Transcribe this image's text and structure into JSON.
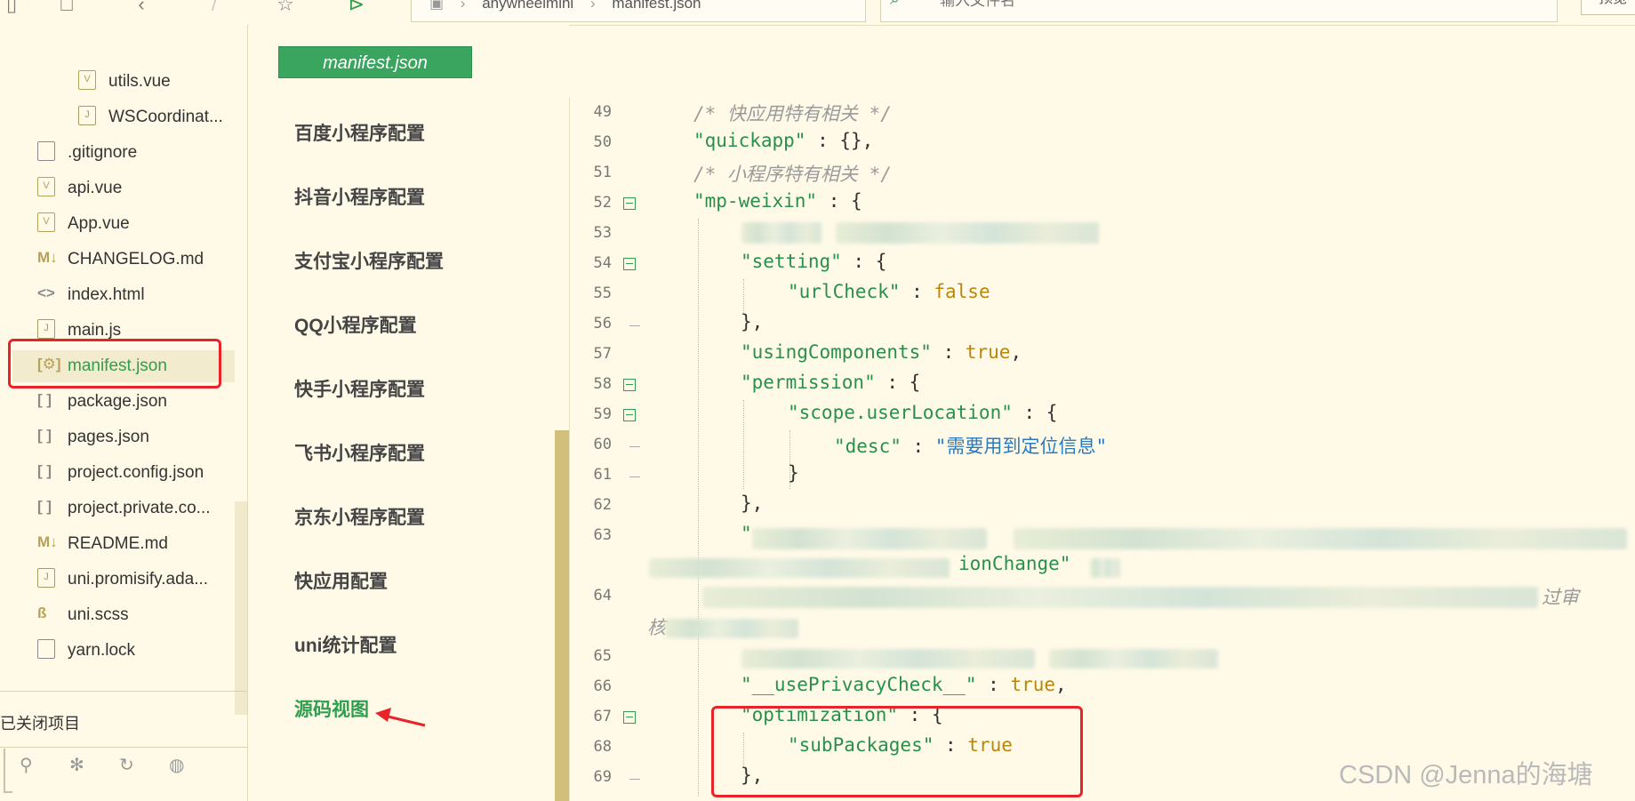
{
  "toolbar": {
    "breadcrumb": [
      "anywheelmini",
      "manifest.json"
    ],
    "search_placeholder": "输入文件名",
    "preview_label": "预览"
  },
  "explorer": {
    "items": [
      {
        "label": "utils.vue",
        "icon": "vue-file-icon"
      },
      {
        "label": "WSCoordinat...",
        "icon": "js-file-icon"
      },
      {
        "label": ".gitignore",
        "icon": "file-icon"
      },
      {
        "label": "api.vue",
        "icon": "vue-file-icon"
      },
      {
        "label": "App.vue",
        "icon": "vue-file-icon"
      },
      {
        "label": "CHANGELOG.md",
        "icon": "markdown-icon"
      },
      {
        "label": "index.html",
        "icon": "html-icon"
      },
      {
        "label": "main.js",
        "icon": "js-file-icon"
      },
      {
        "label": "manifest.json",
        "icon": "settings-file-icon"
      },
      {
        "label": "package.json",
        "icon": "json-icon"
      },
      {
        "label": "pages.json",
        "icon": "json-icon"
      },
      {
        "label": "project.config.json",
        "icon": "json-icon"
      },
      {
        "label": "project.private.co...",
        "icon": "json-icon"
      },
      {
        "label": "README.md",
        "icon": "markdown-icon"
      },
      {
        "label": "uni.promisify.ada...",
        "icon": "js-file-icon"
      },
      {
        "label": "uni.scss",
        "icon": "scss-icon"
      },
      {
        "label": "yarn.lock",
        "icon": "file-icon"
      }
    ],
    "active_item": "manifest.json",
    "closed_projects_label": "已关闭项目"
  },
  "file_tab": {
    "label": "manifest.json"
  },
  "config_nav": {
    "items": [
      "百度小程序配置",
      "抖音小程序配置",
      "支付宝小程序配置",
      "QQ小程序配置",
      "快手小程序配置",
      "飞书小程序配置",
      "京东小程序配置",
      "快应用配置",
      "uni统计配置",
      "源码视图"
    ],
    "selected": "源码视图"
  },
  "editor": {
    "line_numbers": [
      "49",
      "50",
      "51",
      "52",
      "53",
      "54",
      "55",
      "56",
      "57",
      "58",
      "59",
      "60",
      "61",
      "62",
      "63",
      "64",
      "65",
      "66",
      "67",
      "68",
      "69"
    ],
    "lines": {
      "l49": "/* 快应用特有相关 */",
      "l50_key": "\"quickapp\"",
      "l50_rest": " : {},",
      "l51": "/* 小程序特有相关 */",
      "l52_key": "\"mp-weixin\"",
      "l52_rest": " : {",
      "l54_key": "\"setting\"",
      "l54_rest": " : {",
      "l55_key": "\"urlCheck\"",
      "l55_sep": " : ",
      "l55_val": "false",
      "l56": "},",
      "l57_key": "\"usingComponents\"",
      "l57_sep": " : ",
      "l57_val": "true",
      "l57_end": ",",
      "l58_key": "\"permission\"",
      "l58_rest": " : {",
      "l59_key": "\"scope.userLocation\"",
      "l59_rest": " : {",
      "l60_key": "\"desc\"",
      "l60_sep": " : ",
      "l60_val": "\"需要用到定位信息\"",
      "l61": "}",
      "l62": "},",
      "l63_start": "\"",
      "l64_frag_a": "ionChange\"",
      "l64_frag_b": "过审",
      "l64_frag_c": "核",
      "l66_key": "\"__usePrivacyCheck__\"",
      "l66_sep": " : ",
      "l66_val": "true",
      "l66_end": ",",
      "l67_key": "\"optimization\"",
      "l67_rest": " : {",
      "l68_key": "\"subPackages\"",
      "l68_sep": " : ",
      "l68_val": "true",
      "l69": "},"
    }
  },
  "watermark": "CSDN @Jenna的海塘",
  "colors": {
    "accent": "#2f9e4e",
    "highlight_border": "#e8242a",
    "background": "#fffae8"
  }
}
